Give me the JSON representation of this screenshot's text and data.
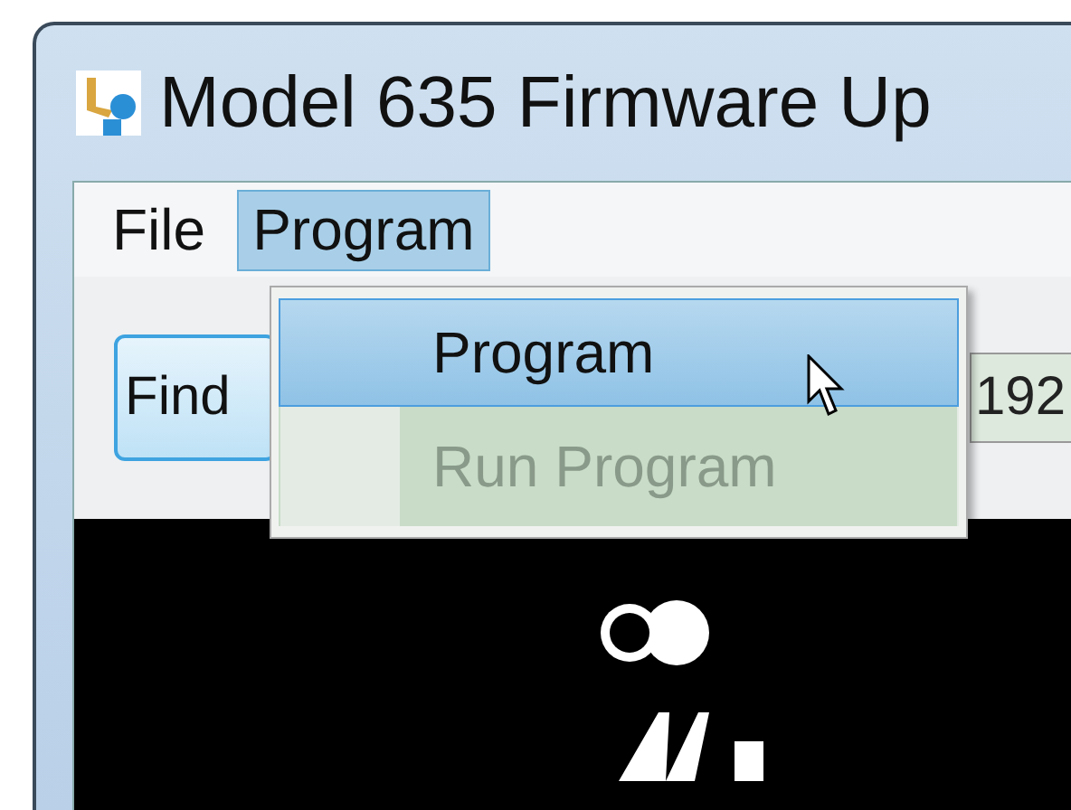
{
  "window": {
    "title": "Model 635 Firmware Up"
  },
  "menu_bar": [
    {
      "label": "File",
      "selected": false
    },
    {
      "label": "Program",
      "selected": true
    }
  ],
  "dropdown": {
    "items": [
      {
        "label": "Program",
        "selected": true,
        "disabled": false
      },
      {
        "label": "Run Program",
        "selected": false,
        "disabled": true
      }
    ]
  },
  "toolbar": {
    "find_button": "Find",
    "address_field": {
      "value": "192"
    }
  }
}
